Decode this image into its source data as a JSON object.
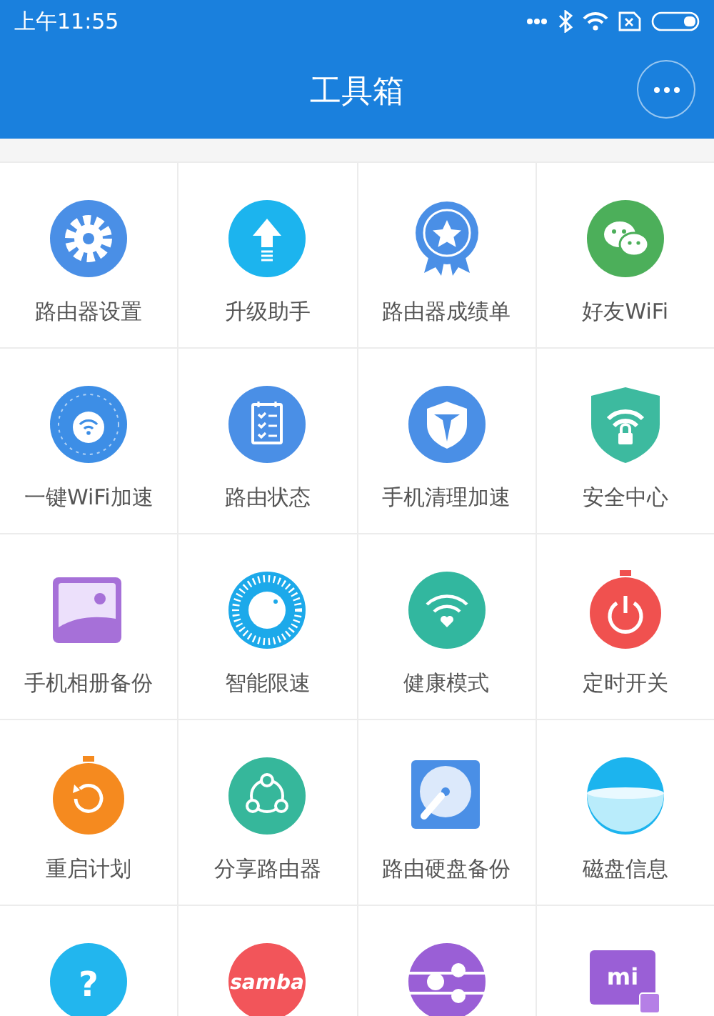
{
  "status_bar": {
    "time": "上午11:55"
  },
  "header": {
    "title": "工具箱"
  },
  "tools": [
    {
      "kind": "gear",
      "color": "#4a8fe6",
      "label": "路由器设置"
    },
    {
      "kind": "upgrade",
      "color": "#1cb4ee",
      "label": "升级助手"
    },
    {
      "kind": "medal",
      "color": "#4a8fe6",
      "label": "路由器成绩单"
    },
    {
      "kind": "chat",
      "color": "#4caf5a",
      "label": "好友WiFi"
    },
    {
      "kind": "wifi-dial",
      "color": "#3d8ee6",
      "label": "一键WiFi加速"
    },
    {
      "kind": "clipboard",
      "color": "#4a8fe6",
      "label": "路由状态"
    },
    {
      "kind": "shield",
      "color": "#4a8fe6",
      "label": "手机清理加速"
    },
    {
      "kind": "lock-shield",
      "color": "#3dba9f",
      "label": "安全中心"
    },
    {
      "kind": "photo",
      "color": "#a670d8",
      "label": "手机相册备份"
    },
    {
      "kind": "speed-dial",
      "color": "#1ca9ea",
      "label": "智能限速"
    },
    {
      "kind": "wifi-heart",
      "color": "#32b79f",
      "label": "健康模式"
    },
    {
      "kind": "power-timer",
      "color": "#f0514f",
      "label": "定时开关"
    },
    {
      "kind": "restart-timer",
      "color": "#f58a1f",
      "label": "重启计划"
    },
    {
      "kind": "share",
      "color": "#36b79b",
      "label": "分享路由器"
    },
    {
      "kind": "disk",
      "color": "#4a8fe6",
      "label": "路由硬盘备份"
    },
    {
      "kind": "bowl",
      "color": "#1cb4ee",
      "label": "磁盘信息"
    },
    {
      "kind": "question",
      "color": "#22b6ee",
      "glyph": "?"
    },
    {
      "kind": "samba",
      "color": "#f2555a",
      "glyph": "samba"
    },
    {
      "kind": "flow",
      "color": "#9a5fd6"
    },
    {
      "kind": "tv",
      "color": "#9a5fd6",
      "glyph": "mi"
    }
  ]
}
